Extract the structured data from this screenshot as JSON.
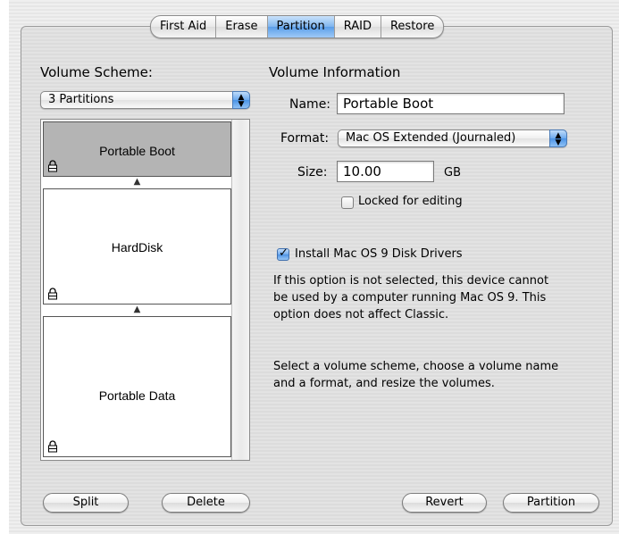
{
  "tabs": [
    "First Aid",
    "Erase",
    "Partition",
    "RAID",
    "Restore"
  ],
  "selected_tab": "Partition",
  "volume_scheme": {
    "label": "Volume Scheme:",
    "selected": "3 Partitions"
  },
  "partitions": [
    {
      "name": "Portable Boot",
      "selected": true
    },
    {
      "name": "HardDisk",
      "selected": false
    },
    {
      "name": "Portable Data",
      "selected": false
    }
  ],
  "volume_info": {
    "heading": "Volume Information",
    "name_label": "Name:",
    "name_value": "Portable Boot",
    "format_label": "Format:",
    "format_value": "Mac OS Extended (Journaled)",
    "size_label": "Size:",
    "size_value": "10.00",
    "size_unit": "GB",
    "locked_label": "Locked for editing",
    "locked_checked": false
  },
  "install_drivers": {
    "label": "Install Mac OS 9 Disk Drivers",
    "checked": true,
    "note_lines": [
      "If this option is not selected, this device cannot",
      "be used by a computer running Mac OS 9.  This",
      "option does not affect Classic."
    ]
  },
  "instructions_lines": [
    "Select a volume scheme, choose a volume name",
    "and a format, and resize the volumes."
  ],
  "buttons": {
    "split": "Split",
    "delete": "Delete",
    "revert": "Revert",
    "partition": "Partition"
  },
  "colors": {
    "accent": "#5a9ee9",
    "selected_partition": "#b4b4b4"
  }
}
